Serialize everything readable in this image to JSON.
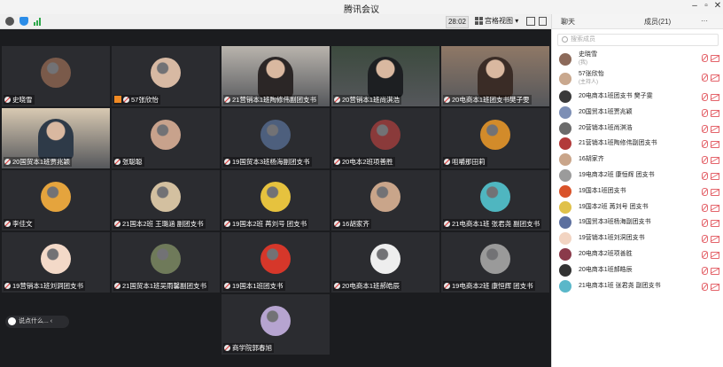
{
  "window": {
    "title": "腾讯会议"
  },
  "toolbar": {
    "time": "28:02",
    "view_label": "宫格视图"
  },
  "panel": {
    "tab_chat": "聊天",
    "tab_members": "成员(21)",
    "more": "···",
    "search_placeholder": "搜索成员",
    "members": [
      {
        "name": "史晓雪",
        "sub": "(我)",
        "color": "#8c6a5a"
      },
      {
        "name": "57张欣怡",
        "sub": "(主持人)",
        "color": "#c9a88e"
      },
      {
        "name": "20电商本1班团支书 樊子雯",
        "color": "#3a3a3a"
      },
      {
        "name": "20国贸本1班贾兆颖",
        "color": "#7d8fb5"
      },
      {
        "name": "20营销本1班尚淇浩",
        "color": "#6b6b6b"
      },
      {
        "name": "21营销本1班陶修伟副团支书",
        "color": "#b23a3a"
      },
      {
        "name": "16胡家齐",
        "color": "#c9a58a"
      },
      {
        "name": "19电商本2班 康恒辉 团支书",
        "color": "#9b9b9b"
      },
      {
        "name": "19国本1班团支书",
        "color": "#d9532a"
      },
      {
        "name": "19国本2班 苒刘号 团支书",
        "color": "#e0c14a"
      },
      {
        "name": "19国贸本3班杨海副团支书",
        "color": "#5c6f9e"
      },
      {
        "name": "19营销本1班刘洞团支书",
        "color": "#f2d4c2"
      },
      {
        "name": "20电商本2班项善胜",
        "color": "#8a3a4a"
      },
      {
        "name": "20电商本1班郝皓辰",
        "color": "#333333"
      },
      {
        "name": "21电商本1班 张君尧 副团支书",
        "color": "#5ab7c9"
      }
    ]
  },
  "tiles": [
    {
      "name": "史晓雪",
      "type": "avatar",
      "color": "#7a5a4a"
    },
    {
      "name": "57张欣怡",
      "type": "avatar",
      "color": "#d7b9a3",
      "host": true
    },
    {
      "name": "21营销本1班陶修伟副团支书",
      "type": "video",
      "bg": "#b9b4ad",
      "skin": "#2b2626"
    },
    {
      "name": "20营销本1班尚淇浩",
      "type": "video",
      "bg": "#3c4a3e",
      "skin": "#1d1f22"
    },
    {
      "name": "20电商本1班团支书樊子雯",
      "type": "video",
      "bg": "#8f7866",
      "skin": "#3a2c26"
    },
    {
      "name": "20国贸本1班贾兆颖",
      "type": "video",
      "bg": "#d8c9b2",
      "skin": "#2e3a48"
    },
    {
      "name": "张聪聪",
      "type": "avatar",
      "color": "#c8a28c"
    },
    {
      "name": "19国贸本3班杨海副团支书",
      "type": "avatar",
      "color": "#4d5f7d"
    },
    {
      "name": "20电本2班项善胜",
      "type": "avatar",
      "color": "#8a3a3a"
    },
    {
      "name": "咀嚼那田莉",
      "type": "avatar",
      "color": "#d28b2a"
    },
    {
      "name": "李佳文",
      "type": "avatar",
      "color": "#e5a43d"
    },
    {
      "name": "21国本2班 王璐涵 副团支书",
      "type": "avatar",
      "color": "#d3c0a0"
    },
    {
      "name": "19国本2班 苒刘号 团支书",
      "type": "avatar",
      "color": "#e6c23e"
    },
    {
      "name": "16胡家齐",
      "type": "avatar",
      "color": "#c9a58a"
    },
    {
      "name": "21电商本1班 张君尧 副团支书",
      "type": "avatar",
      "color": "#4fb6c0"
    },
    {
      "name": "19营销本1班刘洞团支书",
      "type": "avatar",
      "color": "#f3d9c8"
    },
    {
      "name": "21国贸本1班吴雨馨副团支书",
      "type": "avatar",
      "color": "#6f7a5a"
    },
    {
      "name": "19国本1班团支书",
      "type": "avatar",
      "color": "#d6372a"
    },
    {
      "name": "20电商本1班郝皓辰",
      "type": "avatar",
      "color": "#eeeeee"
    },
    {
      "name": "19电商本2班 康恒辉 团支书",
      "type": "avatar",
      "color": "#9a9a9a"
    },
    {
      "name": "商学院郭春旭",
      "type": "avatar",
      "color": "#b6a4d0"
    }
  ],
  "chat_preview": "说点什么..."
}
